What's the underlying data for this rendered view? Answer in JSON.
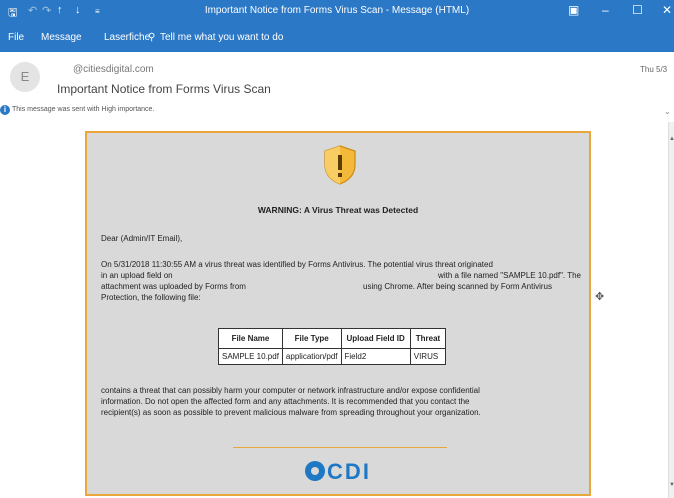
{
  "window": {
    "title": "Important Notice from Forms Virus Scan  -  Message (HTML)",
    "quick_access": [
      "save-icon",
      "undo-icon",
      "redo-icon",
      "up-icon",
      "down-icon",
      "customize-icon"
    ],
    "controls": {
      "restore": "▣",
      "minimize": "–",
      "maximize": "☐",
      "close": "✕"
    }
  },
  "ribbon": {
    "tabs": [
      "File",
      "Message",
      "Laserfiche"
    ],
    "tell_me": "Tell me what you want to do"
  },
  "header": {
    "avatar_initial": "E",
    "from": "@citiesdigital.com",
    "subject": "Important Notice from Forms Virus Scan",
    "date": "Thu 5/3",
    "importance": "This message was sent with High importance."
  },
  "notice": {
    "heading": "WARNING: A Virus Threat was Detected",
    "greeting": "Dear (Admin/IT Email),",
    "para1": {
      "line1": "On 5/31/2018 11:30:55 AM a virus threat was identified by Forms Antivirus. The potential virus threat originated",
      "line2a": "in an upload field on",
      "line2b": "with a file named \"SAMPLE 10.pdf\". The",
      "line3a": "attachment was uploaded by Forms from",
      "line3b": "using Chrome. After being scanned by Form Antivirus",
      "line4": "Protection, the following file:"
    },
    "table": {
      "headers": [
        "File Name",
        "File Type",
        "Upload Field ID",
        "Threat"
      ],
      "rows": [
        [
          "SAMPLE 10.pdf",
          "application/pdf",
          "Field2",
          "VIRUS"
        ]
      ]
    },
    "para2": {
      "line1": "contains a threat that can possibly harm your computer or network infrastructure and/or expose confidential",
      "line2": "information. Do not open the affected form and any attachments. It is recommended that you contact the",
      "line3": "recipient(s) as soon as possible to prevent malicious malware from spreading throughout your organization."
    },
    "logo_text": "CDI",
    "colors": {
      "border": "#e9a63a",
      "card": "#d9d9d9",
      "brand": "#1f78c4",
      "shield": "#f5b93a"
    }
  }
}
